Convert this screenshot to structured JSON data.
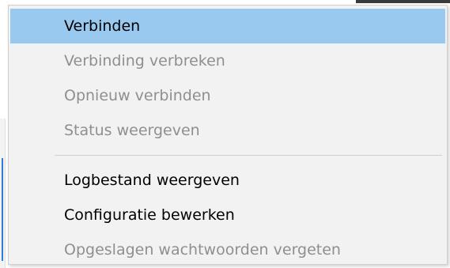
{
  "menu": {
    "group1": [
      {
        "label": "Verbinden",
        "enabled": true,
        "highlighted": true
      },
      {
        "label": "Verbinding verbreken",
        "enabled": false,
        "highlighted": false
      },
      {
        "label": "Opnieuw verbinden",
        "enabled": false,
        "highlighted": false
      },
      {
        "label": "Status weergeven",
        "enabled": false,
        "highlighted": false
      }
    ],
    "group2": [
      {
        "label": "Logbestand weergeven",
        "enabled": true,
        "highlighted": false
      },
      {
        "label": "Configuratie bewerken",
        "enabled": true,
        "highlighted": false
      },
      {
        "label": "Opgeslagen wachtwoorden vergeten",
        "enabled": false,
        "highlighted": false
      }
    ]
  },
  "colors": {
    "menu_background": "#f2f2f2",
    "highlight": "#99c9ef",
    "enabled_text": "#000000",
    "disabled_text": "#8f8f8f",
    "separator": "#cfcfcf"
  }
}
